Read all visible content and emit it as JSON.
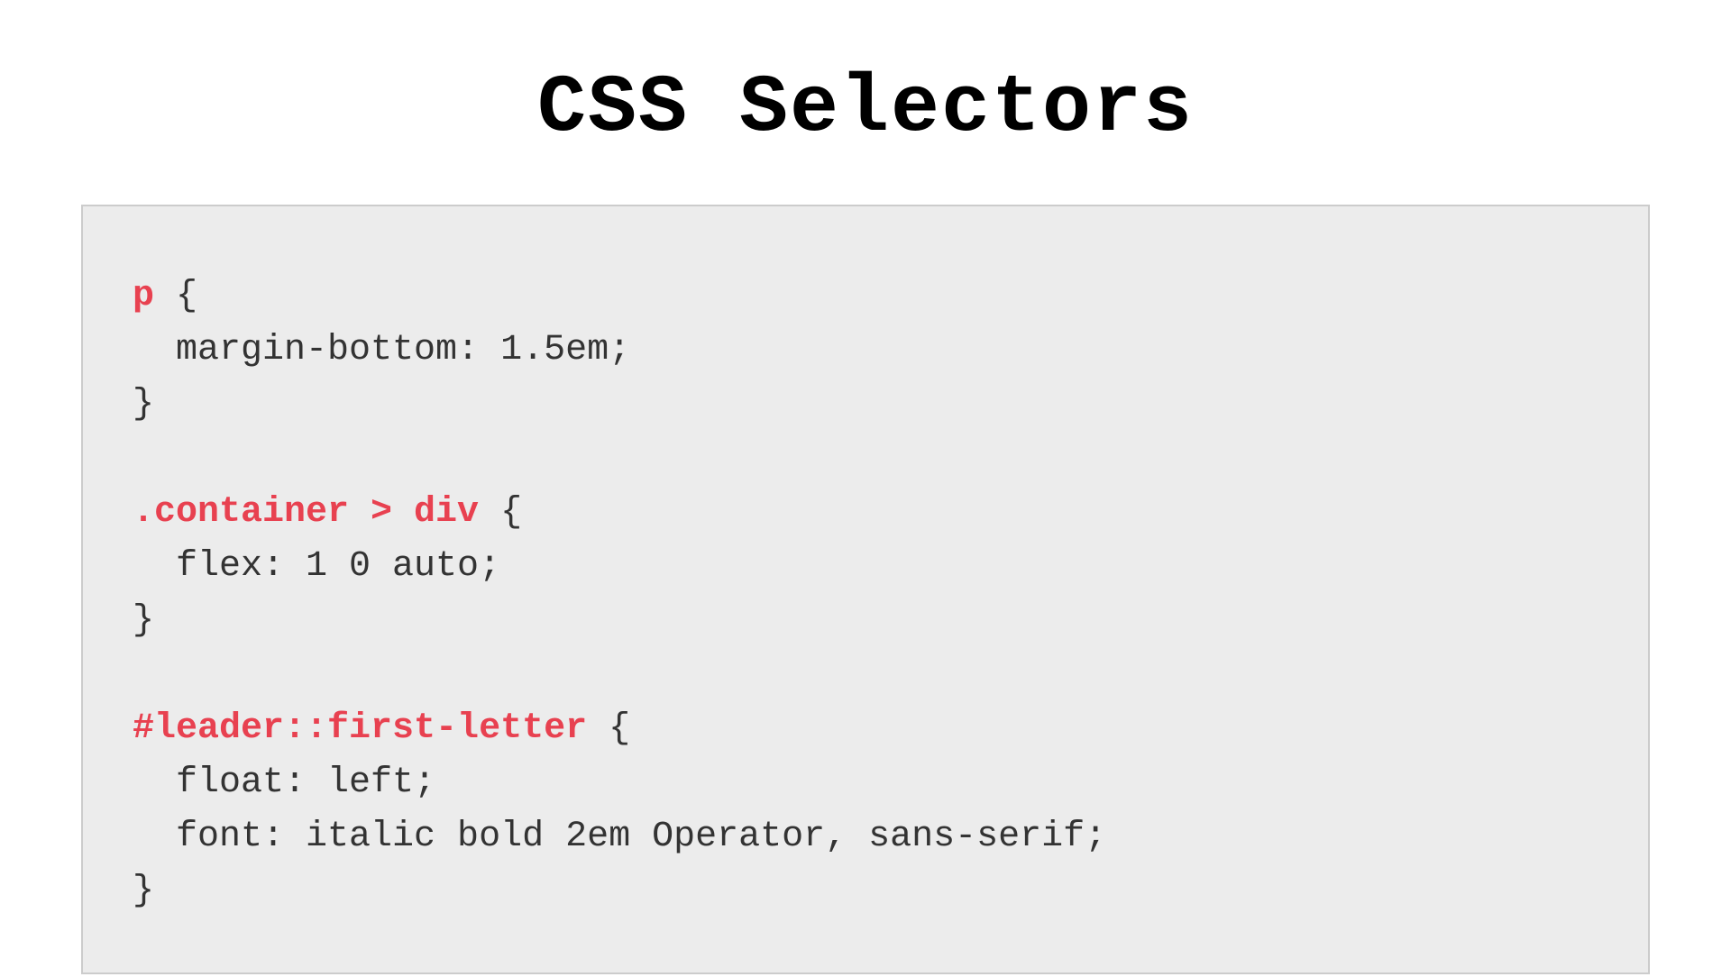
{
  "title": "CSS Selectors",
  "colors": {
    "selector": "#e84150",
    "text": "#333333",
    "codeBg": "#ececec",
    "codeBorder": "#cccccc"
  },
  "code": {
    "rules": [
      {
        "selector": "p",
        "open": " {",
        "declarations": [
          "  margin-bottom: 1.5em;"
        ],
        "close": "}"
      },
      {
        "selector": ".container > div",
        "open": " {",
        "declarations": [
          "  flex: 1 0 auto;"
        ],
        "close": "}"
      },
      {
        "selector": "#leader::first-letter",
        "open": " {",
        "declarations": [
          "  float: left;",
          "  font: italic bold 2em Operator, sans-serif;"
        ],
        "close": "}"
      }
    ]
  }
}
